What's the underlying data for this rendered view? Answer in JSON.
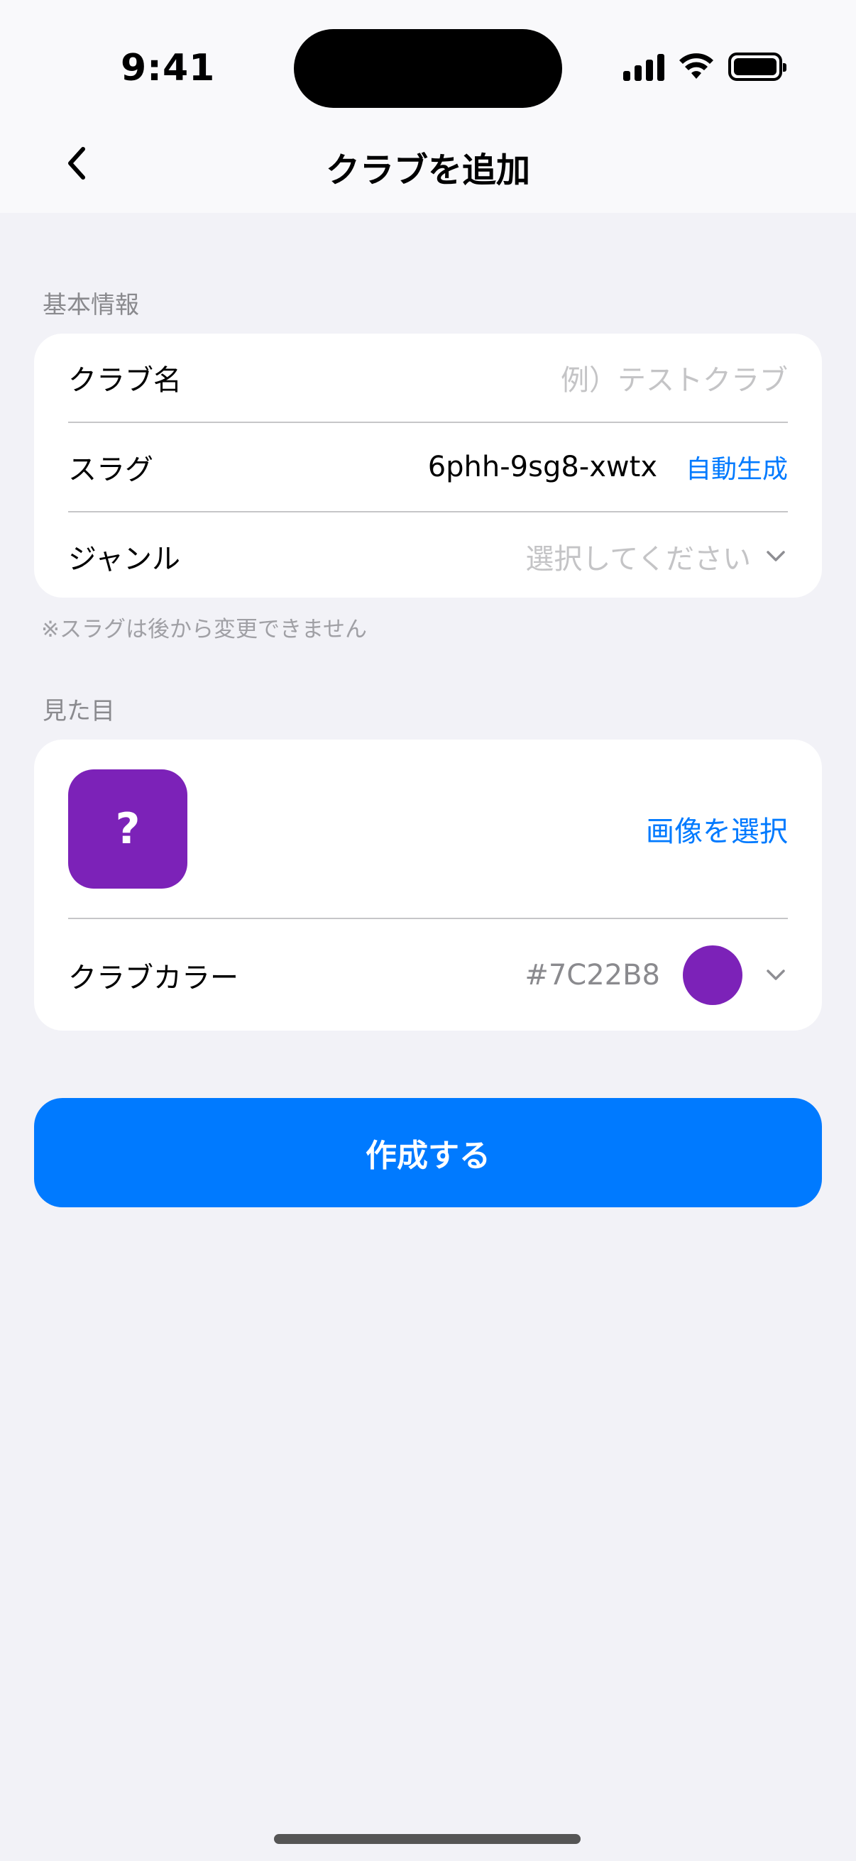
{
  "status_bar": {
    "time": "9:41"
  },
  "header": {
    "title": "クラブを追加"
  },
  "basic_section": {
    "header": "基本情報",
    "name_label": "クラブ名",
    "name_placeholder": "例）テストクラブ",
    "slug_label": "スラグ",
    "slug_value": "6phh-9sg8-xwtx",
    "auto_generate": "自動生成",
    "genre_label": "ジャンル",
    "genre_placeholder": "選択してください",
    "footnote": "※スラグは後から変更できません"
  },
  "appearance_section": {
    "header": "見た目",
    "icon_text": "?",
    "select_image": "画像を選択",
    "color_label": "クラブカラー",
    "color_value": "#7C22B8"
  },
  "actions": {
    "create": "作成する"
  },
  "colors": {
    "accent": "#007aff",
    "club": "#7C22B8"
  },
  "icons": {
    "back": "chevron-left-icon",
    "genre_dropdown": "chevron-down-icon",
    "color_dropdown": "chevron-down-icon"
  }
}
